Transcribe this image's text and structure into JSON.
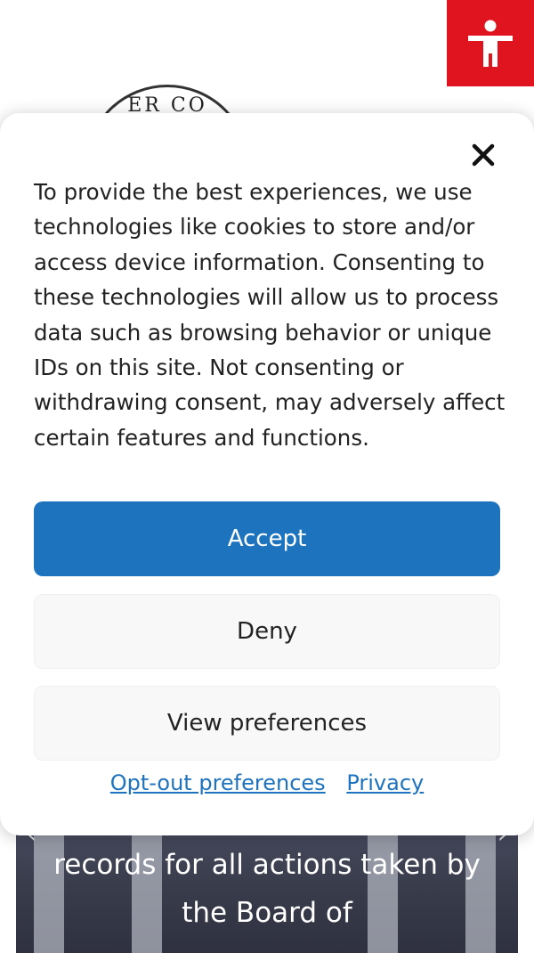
{
  "background": {
    "seal_text": "ER CO",
    "hero_text": "records for all actions taken by the Board of",
    "hero_prev_icon": "chevron-left",
    "hero_next_icon": "chevron-right"
  },
  "accessibility_button": {
    "icon": "accessibility-person-icon",
    "color": "#e0141e"
  },
  "cookie_banner": {
    "close_icon": "close-x",
    "message": "To provide the best experiences, we use technologies like cookies to store and/or access device information. Consenting to these technologies will allow us to process data such as browsing behavior or unique IDs on this site. Not consenting or withdrawing consent, may adversely affect certain features and functions.",
    "accept_label": "Accept",
    "deny_label": "Deny",
    "preferences_label": "View preferences",
    "links": {
      "opt_out": "Opt-out preferences",
      "privacy": "Privacy"
    },
    "accent_color": "#1e73be"
  }
}
